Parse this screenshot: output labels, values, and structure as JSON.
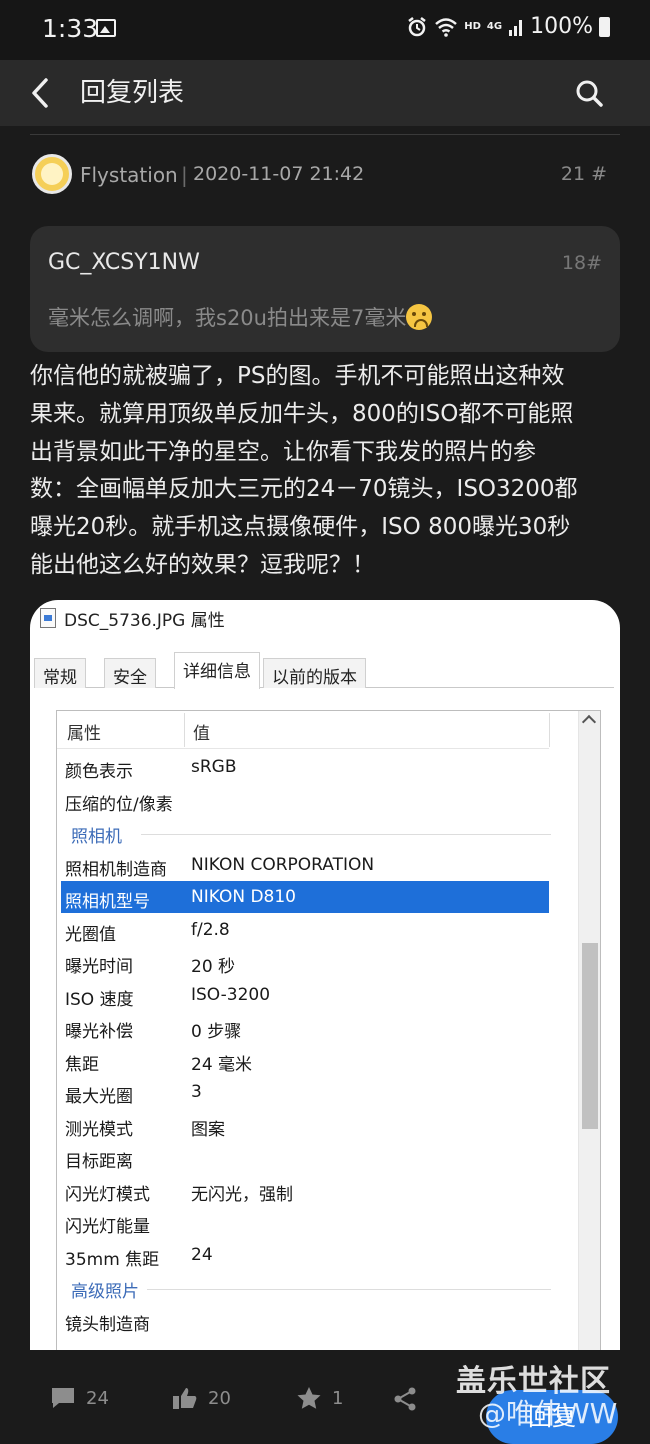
{
  "status_bar": {
    "time": "1:33",
    "network_label": "HD",
    "network_gen": "4G",
    "battery": "100%"
  },
  "header": {
    "title": "回复列表"
  },
  "post": {
    "author": "Flystation",
    "separator": "|",
    "datetime": "2020-11-07 21:42",
    "floor": "21 #",
    "quote": {
      "user": "GC_XCSY1NW",
      "floor": "18#",
      "text": "毫米怎么调啊，我s20u拍出来是7毫米"
    },
    "body_lines": [
      "你信他的就被骗了，PS的图。手机不可能照出这种效",
      "果来。就算用顶级单反加牛头，800的ISO都不可能照",
      "出背景如此干净的星空。让你看下我发的照片的参",
      "数：全画幅单反加大三元的24－70镜头，ISO3200都",
      "曝光20秒。就手机这点摄像硬件，ISO 800曝光30秒",
      "能出他这么好的效果？逗我呢？！"
    ]
  },
  "image": {
    "window_title": "DSC_5736.JPG 属性",
    "tabs": [
      "常规",
      "安全",
      "详细信息",
      "以前的版本"
    ],
    "active_tab": "详细信息",
    "col_property": "属性",
    "col_value": "值",
    "rows": [
      {
        "k": "颜色表示",
        "v": "sRGB"
      },
      {
        "k": "压缩的位/像素",
        "v": ""
      },
      {
        "group": "照相机"
      },
      {
        "k": "照相机制造商",
        "v": "NIKON CORPORATION"
      },
      {
        "k": "照相机型号",
        "v": "NIKON D810",
        "selected": true
      },
      {
        "k": "光圈值",
        "v": "f/2.8"
      },
      {
        "k": "曝光时间",
        "v": "20 秒"
      },
      {
        "k": "ISO 速度",
        "v": "ISO-3200"
      },
      {
        "k": "曝光补偿",
        "v": "0 步骤"
      },
      {
        "k": "焦距",
        "v": "24 毫米"
      },
      {
        "k": "最大光圈",
        "v": "3"
      },
      {
        "k": "测光模式",
        "v": "图案"
      },
      {
        "k": "目标距离",
        "v": ""
      },
      {
        "k": "闪光灯模式",
        "v": "无闪光，强制"
      },
      {
        "k": "闪光灯能量",
        "v": ""
      },
      {
        "k": "35mm 焦距",
        "v": "24"
      },
      {
        "group": "高级照片"
      },
      {
        "k": "镜头制造商",
        "v": ""
      }
    ]
  },
  "bottom_bar": {
    "comments": "24",
    "likes": "20",
    "stars": "1",
    "reply_label": "回复"
  },
  "watermark": {
    "line1": "盖乐世社区",
    "line2": "@唯伟WW"
  },
  "colors": {
    "background": "#1b1b1b",
    "header": "#2a2a2a",
    "accent": "#2a7ee6",
    "selection": "#1e6fd9"
  }
}
